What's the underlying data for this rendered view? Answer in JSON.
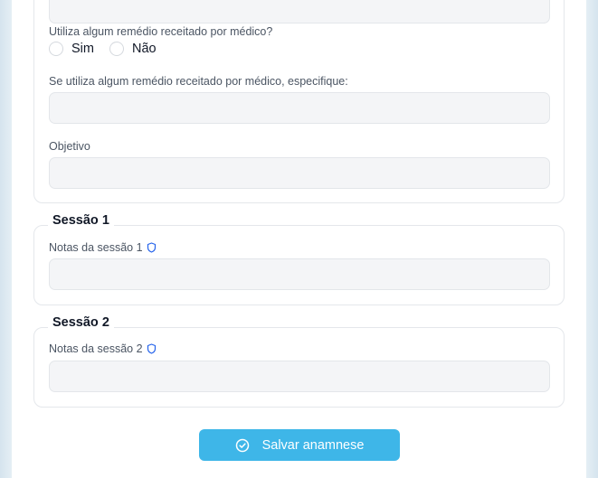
{
  "form": {
    "medication_question": "Utiliza algum remédio receitado por médico?",
    "medication_options": [
      "Sim",
      "Não"
    ],
    "medication_specify_label": "Se utiliza algum remédio receitado por médico, especifique:",
    "medication_specify_value": "",
    "objective_label": "Objetivo",
    "objective_value": "",
    "previous_field_value": ""
  },
  "sessions": [
    {
      "title": "Sessão 1",
      "notes_label": "Notas da sessão 1",
      "notes_value": ""
    },
    {
      "title": "Sessão 2",
      "notes_label": "Notas da sessão 2",
      "notes_value": ""
    }
  ],
  "actions": {
    "save_label": "Salvar anamnese"
  },
  "colors": {
    "accent": "#3eb6e8",
    "shield_icon": "#2563eb",
    "input_bg": "#f4f5f7",
    "page_bg": "#dfeaf2"
  }
}
